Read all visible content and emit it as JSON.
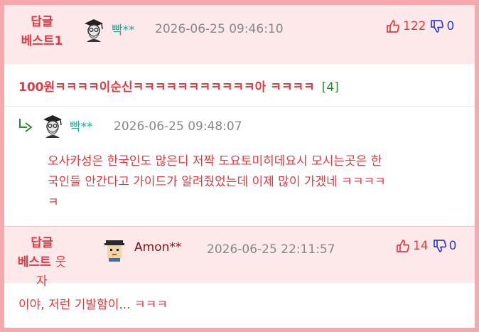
{
  "comments": [
    {
      "badge_line1": "답글",
      "badge_line2": "베스트1",
      "nick": "빡**",
      "timestamp": "2026-06-25 09:46:10",
      "up_count": "122",
      "down_count": "0",
      "text": "100원ㅋㅋㅋㅋ이순신ㅋㅋㅋㅋㅋㅋㅋㅋㅋㅋㅋ아 ㅋㅋㅋㅋ",
      "reply_count": "[4]"
    },
    {
      "nick": "빡**",
      "timestamp": "2026-06-25 09:48:07",
      "text_line1": "오사카성은 한국인도 많은디 저짝 도요토미히데요시 모시는곳은 한",
      "text_line2": "국인들 안간다고 가이드가 알려줬었는데 이제 많이 가겠네 ㅋㅋㅋㅋ",
      "text_line3": "ㅋ"
    },
    {
      "badge_line1": "답글",
      "badge_line2": "베스트",
      "nick_prefix": "웃자",
      "nick": "Amon**",
      "timestamp": "2026-06-25 22:11:57",
      "up_count": "14",
      "down_count": "0",
      "text": "이야, 저런 기발함이... ㅋㅋㅋ"
    }
  ],
  "colors": {
    "border": "#f6a8ac",
    "header_bg": "#fde8ea",
    "red": "#e8373d",
    "teal": "#20a89a",
    "blue": "#2f3fd0",
    "green": "#2a8a2a",
    "dark_red": "#8a1010",
    "gray": "#888888"
  }
}
